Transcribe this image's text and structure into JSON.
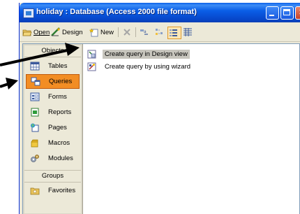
{
  "window": {
    "title": "holiday : Database (Access 2000 file format)"
  },
  "toolbar": {
    "open_label": "Open",
    "design_label": "Design",
    "new_label": "New"
  },
  "objects_bar": {
    "objects_header": "Objects",
    "items": [
      {
        "label": "Tables",
        "icon": "table-icon"
      },
      {
        "label": "Queries",
        "icon": "query-icon",
        "selected": true
      },
      {
        "label": "Forms",
        "icon": "form-icon"
      },
      {
        "label": "Reports",
        "icon": "report-icon"
      },
      {
        "label": "Pages",
        "icon": "page-icon"
      },
      {
        "label": "Macros",
        "icon": "macro-icon"
      },
      {
        "label": "Modules",
        "icon": "module-icon"
      }
    ],
    "groups_header": "Groups",
    "groups": [
      {
        "label": "Favorites",
        "icon": "favorites-folder-icon"
      }
    ]
  },
  "list": {
    "items": [
      {
        "label": "Create query in Design view",
        "selected": true
      },
      {
        "label": "Create query by using wizard"
      }
    ]
  },
  "colors": {
    "titlebar": "#0a5fe7",
    "selected_nav": "#f28d24",
    "panel": "#ece9d8"
  }
}
